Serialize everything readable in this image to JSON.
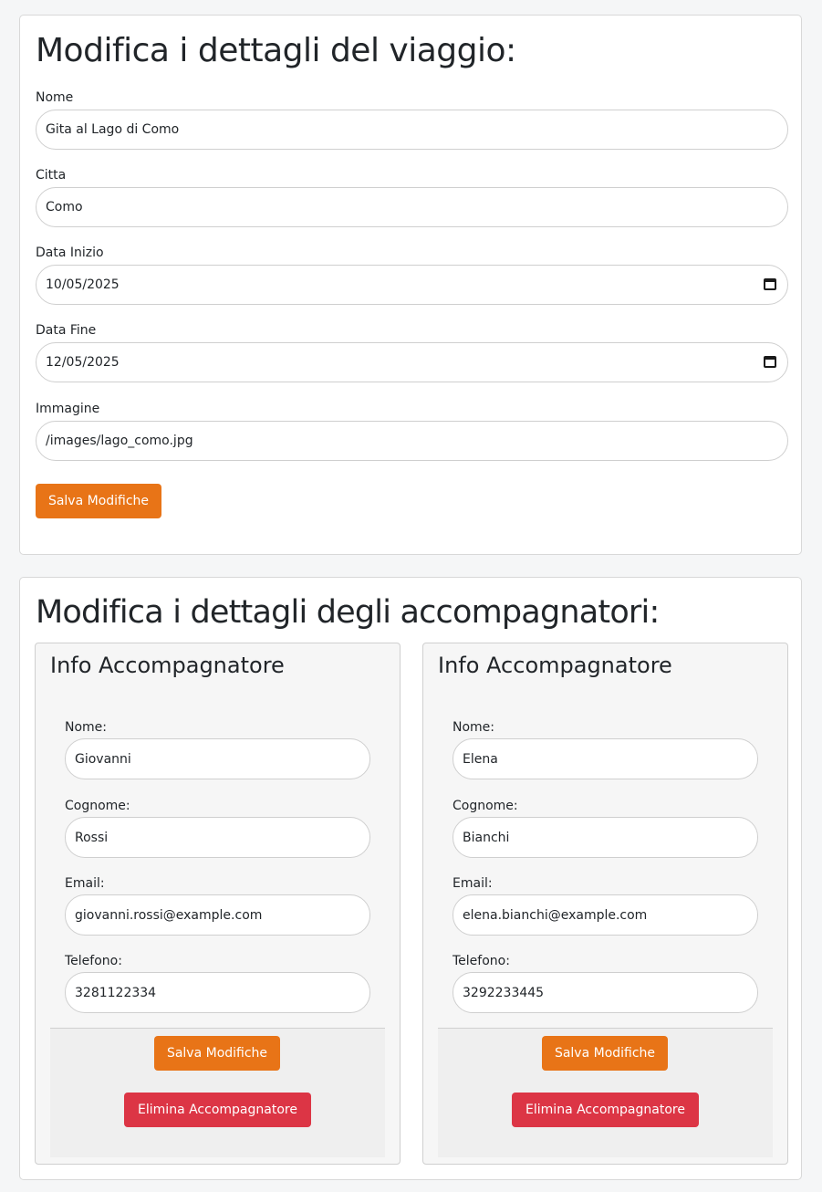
{
  "trip": {
    "title": "Modifica i dettagli del viaggio:",
    "fields": [
      {
        "label": "Nome",
        "value": "Gita al Lago di Como"
      },
      {
        "label": "Citta",
        "value": "Como"
      },
      {
        "label": "Data Inizio",
        "value": "10/05/2025"
      },
      {
        "label": "Data Fine",
        "value": "12/05/2025"
      },
      {
        "label": "Immagine",
        "value": "/images/lago_como.jpg"
      }
    ],
    "save_label": "Salva Modifiche"
  },
  "companions": {
    "title": "Modifica i dettagli degli accompagnatori:",
    "items": [
      {
        "panel_title": "Info Accompagnatore",
        "nome_label": "Nome:",
        "nome": "Giovanni",
        "cognome_label": "Cognome:",
        "cognome": "Rossi",
        "email_label": "Email:",
        "email": "giovanni.rossi@example.com",
        "telefono_label": "Telefono:",
        "telefono": "3281122334",
        "save_label": "Salva Modifiche",
        "delete_label": "Elimina Accompagnatore"
      },
      {
        "panel_title": "Info Accompagnatore",
        "nome_label": "Nome:",
        "nome": "Elena",
        "cognome_label": "Cognome:",
        "cognome": "Bianchi",
        "email_label": "Email:",
        "email": "elena.bianchi@example.com",
        "telefono_label": "Telefono:",
        "telefono": "3292233445",
        "save_label": "Salva Modifiche",
        "delete_label": "Elimina Accompagnatore"
      }
    ]
  },
  "colors": {
    "accent_orange": "#e87417",
    "danger_red": "#dc3545",
    "page_background": "#f5f6f7"
  },
  "icons": {
    "date_picker": "calendar-icon"
  }
}
